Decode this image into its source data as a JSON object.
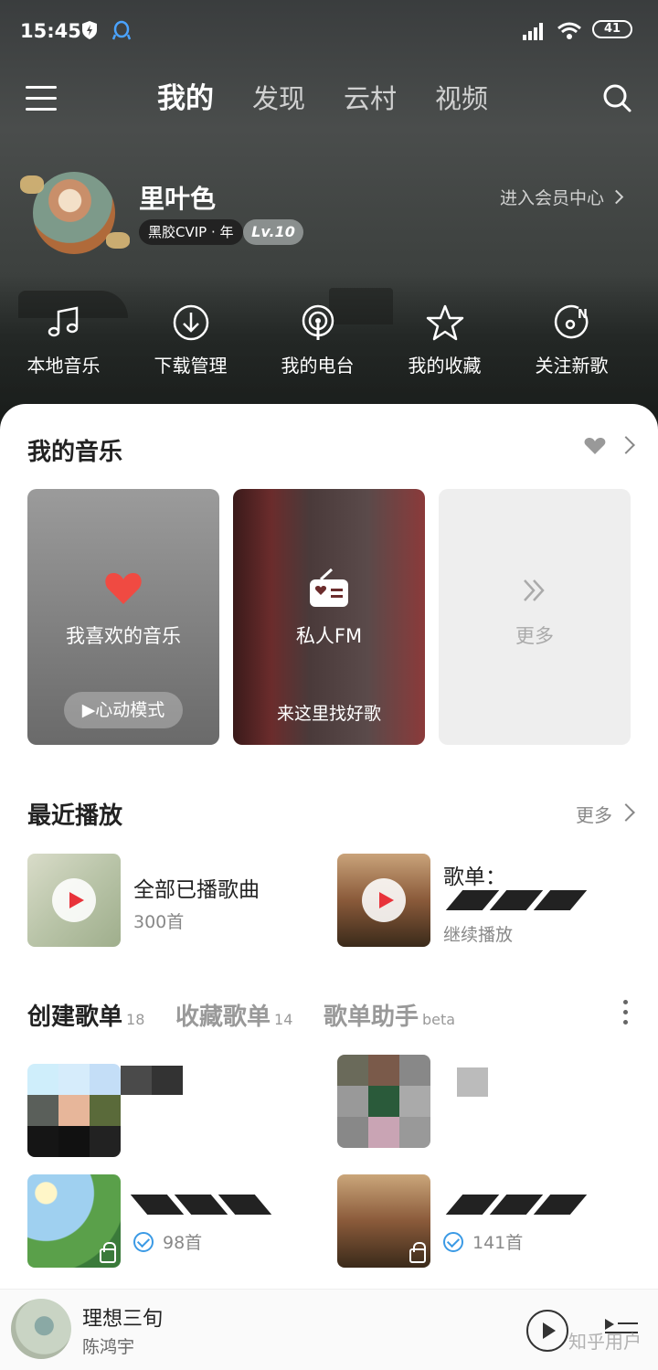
{
  "status_bar": {
    "time": "15:45",
    "battery": "41"
  },
  "nav": {
    "tabs": [
      "我的",
      "发现",
      "云村",
      "视频"
    ]
  },
  "profile": {
    "username": "里叶色",
    "vip_badge": "黑胶CVIP · 年",
    "level": "Lv.10",
    "vip_center": "进入会员中心"
  },
  "quick_actions": [
    {
      "label": "本地音乐",
      "icon": "music-note-icon"
    },
    {
      "label": "下载管理",
      "icon": "download-icon"
    },
    {
      "label": "我的电台",
      "icon": "podcast-icon"
    },
    {
      "label": "我的收藏",
      "icon": "star-icon"
    },
    {
      "label": "关注新歌",
      "icon": "new-song-icon"
    }
  ],
  "my_music": {
    "title": "我的音乐",
    "cards": [
      {
        "label": "我喜欢的音乐",
        "button": "▶心动模式"
      },
      {
        "label": "私人FM",
        "sub": "来这里找好歌"
      },
      {
        "label": "更多"
      }
    ]
  },
  "recent": {
    "title": "最近播放",
    "more": "更多",
    "items": [
      {
        "title": "全部已播歌曲",
        "sub": "300首"
      },
      {
        "title": "歌单：",
        "sub": "继续播放"
      }
    ]
  },
  "playlists": {
    "tabs": [
      {
        "label": "创建歌单",
        "count": "18"
      },
      {
        "label": "收藏歌单",
        "count": "14"
      },
      {
        "label": "歌单助手",
        "count": "beta"
      }
    ],
    "items": [
      {
        "count": "98首"
      },
      {
        "count": "141首"
      }
    ]
  },
  "player": {
    "title": "理想三旬",
    "artist": "陈鸿宇"
  },
  "watermark": "知乎用户",
  "colors": {
    "accent": "#e8333a",
    "check": "#3b9ae5"
  }
}
